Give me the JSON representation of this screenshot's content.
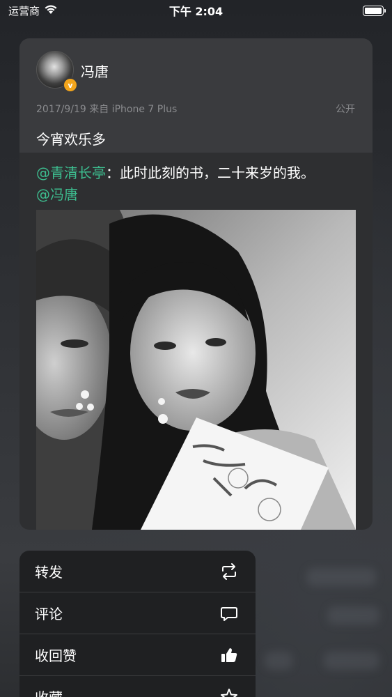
{
  "status_bar": {
    "carrier": "运营商",
    "time": "下午 2:04"
  },
  "post": {
    "author": "冯唐",
    "verified_badge": "v",
    "meta": "2017/9/19 来自 iPhone 7 Plus",
    "visibility": "公开",
    "text": "今宵欢乐多"
  },
  "repost": {
    "mention_1": "@青清长亭",
    "body": "：此时此刻的书，二十来岁的我。",
    "mention_2": "@冯唐"
  },
  "menu": {
    "items": [
      {
        "label": "转发",
        "icon": "repost-icon"
      },
      {
        "label": "评论",
        "icon": "comment-icon"
      },
      {
        "label": "收回赞",
        "icon": "thumbs-up-filled-icon"
      },
      {
        "label": "收藏",
        "icon": "star-icon"
      }
    ]
  },
  "colors": {
    "mention": "#3dbd8f",
    "verified": "#f3a51b",
    "card": "#3a3b3e",
    "menu": "#1f2022"
  }
}
